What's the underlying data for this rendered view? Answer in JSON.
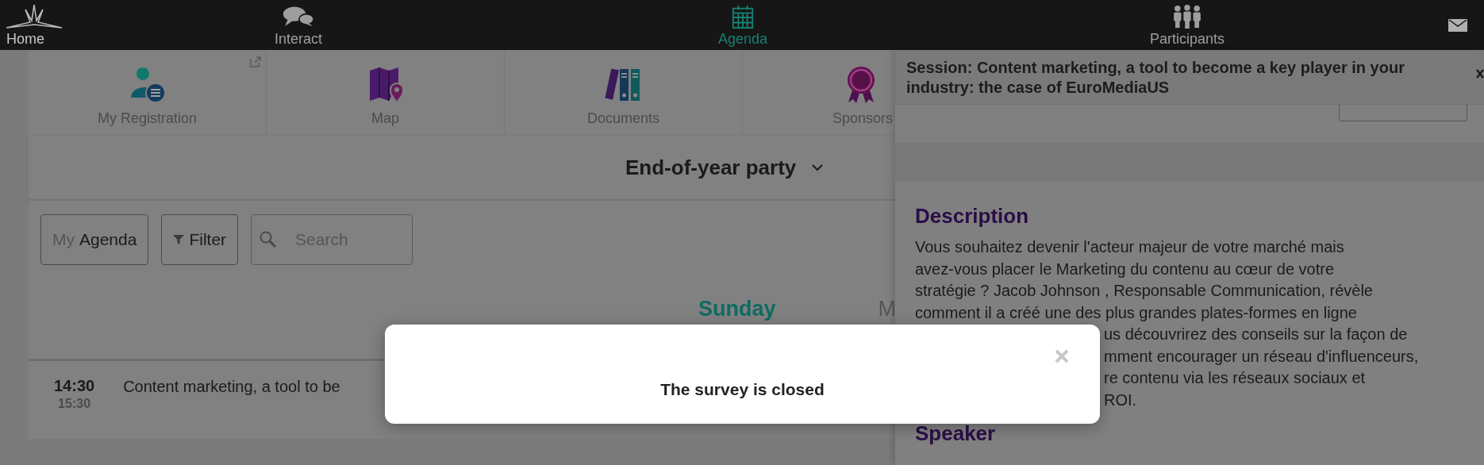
{
  "nav": {
    "items": [
      {
        "label": "Home",
        "kind": "logo",
        "selected": false
      },
      {
        "label": "Interact",
        "kind": "chat",
        "selected": false
      },
      {
        "label": "Agenda",
        "kind": "calendar",
        "selected": true
      },
      {
        "label": "Participants",
        "kind": "people",
        "selected": false
      }
    ]
  },
  "quick_links": [
    {
      "label": "My Registration",
      "kind": "registration",
      "external": true
    },
    {
      "label": "Map",
      "kind": "map",
      "external": false
    },
    {
      "label": "Documents",
      "kind": "binders",
      "external": false
    },
    {
      "label": "Sponsors",
      "kind": "ribbon",
      "external": false
    }
  ],
  "event_selector": {
    "value": "End-of-year party"
  },
  "toolbar": {
    "agenda_button": {
      "prefix": "My",
      "label": "Agenda"
    },
    "filter_button": {
      "label": "Filter"
    },
    "search": {
      "placeholder": "Search"
    }
  },
  "days": [
    {
      "label": "Sunday",
      "selected": true
    },
    {
      "label": "M",
      "selected": false
    }
  ],
  "sessions": [
    {
      "start": "14:30",
      "end": "15:30",
      "title": "Content marketing, a tool to be"
    }
  ],
  "panel": {
    "title": "Session: Content marketing, a tool to become a key player in your industry: the case of EuroMediaUS",
    "sections": [
      {
        "heading": "Description",
        "lines": [
          {
            "kind": "full",
            "text": "Vous souhaitez devenir l'acteur majeur de votre marché mais"
          },
          {
            "kind": "full",
            "text": "avez-vous placer le Marketing du contenu au cœur de votre"
          },
          {
            "kind": "full",
            "text": "stratégie ? Jacob Johnson , Responsable Communication, révèle"
          },
          {
            "kind": "full",
            "text": "comment il a créé une des plus grandes plates-formes en ligne"
          },
          {
            "kind": "tail",
            "text": "us découvrirez des conseils sur la façon de"
          },
          {
            "kind": "tail",
            "text": "mment encourager un réseau d'influenceurs,"
          },
          {
            "kind": "tail",
            "text": "re contenu via les réseaux sociaux et"
          },
          {
            "kind": "tail",
            "text": "ROI."
          }
        ]
      },
      {
        "heading": "Speaker"
      }
    ]
  },
  "modal": {
    "message": "The survey is closed"
  }
}
